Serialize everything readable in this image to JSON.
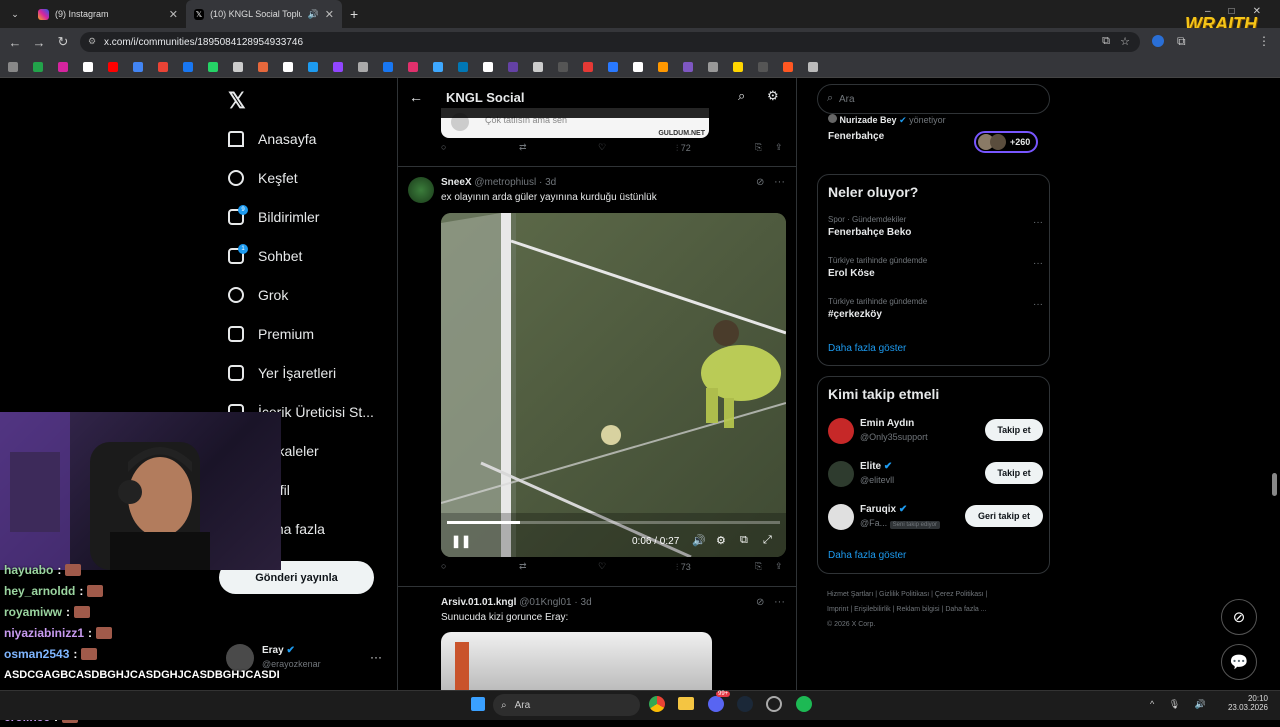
{
  "browser": {
    "tabs": [
      {
        "label": "(9) Instagram",
        "active": false
      },
      {
        "label": "(10) KNGL Social Topluluk / ...",
        "active": true
      }
    ],
    "url": "x.com/i/communities/1895084128954933746"
  },
  "watermark": "WRAITH",
  "sidebar": {
    "items": [
      {
        "label": "Anasayfa",
        "icon": "home-icon"
      },
      {
        "label": "Keşfet",
        "icon": "search-icon"
      },
      {
        "label": "Bildirimler",
        "icon": "bell-icon",
        "badge": "9"
      },
      {
        "label": "Sohbet",
        "icon": "mail-icon",
        "badge": "1"
      },
      {
        "label": "Grok",
        "icon": "grok-icon"
      },
      {
        "label": "Premium",
        "icon": "premium-icon"
      },
      {
        "label": "Yer İşaretleri",
        "icon": "bookmark-icon"
      },
      {
        "label": "İçerik Üreticisi St...",
        "icon": "creator-icon"
      },
      {
        "label": "Makaleler",
        "icon": "article-icon"
      },
      {
        "label": "Profil",
        "icon": "profile-icon"
      },
      {
        "label": "Daha fazla",
        "icon": "more-icon"
      }
    ],
    "post_button": "Gönderi yayınla",
    "account": {
      "name": "Eray",
      "handle": "@erayozkenar"
    }
  },
  "feed": {
    "header_title": "KNGL Social",
    "prev_post": {
      "preview_text": "Çok tatlısın ama sen",
      "watermark": "GULDUM.NET",
      "views": "72"
    },
    "post1": {
      "name": "SneeX",
      "handle": "@metrophiusl",
      "time": "3d",
      "text": "ex olayının arda güler yayınına kurduğu üstünlük",
      "video_time": "0:06 / 0:27",
      "video_progress": 0.22,
      "views": "73"
    },
    "post2": {
      "name": "Arsiv.01.01.kngl",
      "handle": "@01Kngl01",
      "time": "3d",
      "text": "Sunucuda kizi gorunce Eray:"
    }
  },
  "right": {
    "search_placeholder": "Ara",
    "community": {
      "owner": "Nurizade Bey",
      "owner_role": "yönetiyor",
      "name": "Fenerbahçe",
      "members": "+260"
    },
    "trends_title": "Neler oluyor?",
    "trends": [
      {
        "meta": "Spor · Gündemdekiler",
        "title": "Fenerbahçe Beko"
      },
      {
        "meta": "Türkiye tarihinde gündemde",
        "title": "Erol Köse"
      },
      {
        "meta": "Türkiye tarihinde gündemde",
        "title": "#çerkezköy"
      }
    ],
    "trends_more": "Daha fazla göster",
    "follow_title": "Kimi takip etmeli",
    "follow": [
      {
        "name": "Emin Aydın",
        "handle": "@Only35support",
        "button": "Takip et",
        "verified": false
      },
      {
        "name": "Elite",
        "handle": "@elitevll",
        "button": "Takip et",
        "verified": true
      },
      {
        "name": "Faruqix",
        "handle": "@Fa...",
        "follows_you": "Seni takip ediyor",
        "button": "Geri takip et",
        "verified": true
      }
    ],
    "follow_more": "Daha fazla göster",
    "footer": [
      "Hizmet Şartları",
      "Gizlilik Politikası",
      "Çerez Politikası",
      "Imprint",
      "Erişilebilirlik",
      "Reklam bilgisi",
      "Daha fazla ...",
      "© 2026 X Corp."
    ]
  },
  "chat": [
    {
      "user": "hayuabo",
      "msg": ":",
      "color": "#9bd5a0"
    },
    {
      "user": "hey_arnoldd",
      "msg": ":",
      "color": "#9bd5a0"
    },
    {
      "user": "royamiww",
      "msg": ":",
      "color": "#9bd5a0"
    },
    {
      "user": "niyaziabinizz1",
      "msg": ":",
      "color": "#c89bf0"
    },
    {
      "user": "osman2543",
      "msg": ":",
      "color": "#7fb6ff"
    },
    {
      "user": "",
      "msg": "ASDCGAGBCASDBGHJCASDGHJCASDBGHJCASDI",
      "color": "#fff"
    },
    {
      "user": "",
      "msg": "SDGHCBVBGHJBASDCVJBCBASDGHCGHJCBBASI",
      "color": "#fff"
    },
    {
      "user": "erolinee",
      "msg": ":",
      "color": "#c89bf0"
    }
  ],
  "taskbar": {
    "search": "Ara",
    "time": "20:10",
    "date": "23.03.2026",
    "badge": "99+"
  },
  "colors": {
    "accent": "#1d9bf0",
    "bg": "#000000",
    "border": "#2f3336",
    "muted": "#71767b"
  }
}
